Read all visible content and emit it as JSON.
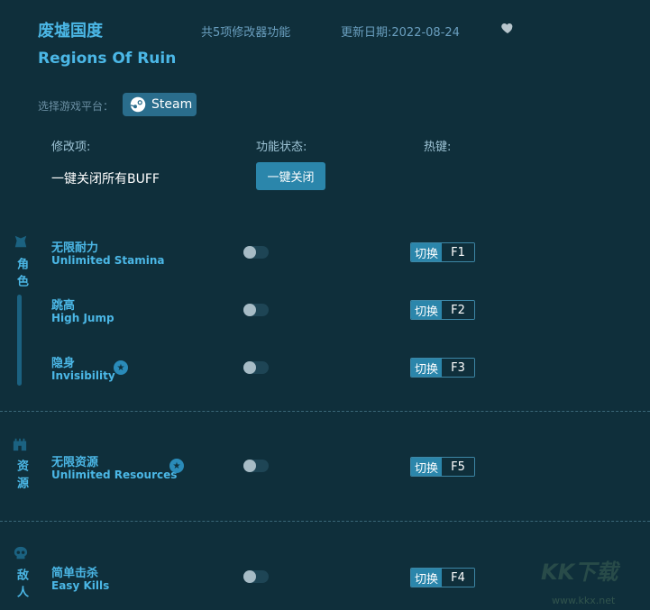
{
  "header": {
    "title_cn": "废墟国度",
    "title_en": "Regions Of Ruin",
    "feature_count": "共5项修改器功能",
    "update_date": "更新日期:2022-08-24",
    "favorite_icon": "heart-icon"
  },
  "platform": {
    "label": "选择游戏平台：",
    "steam_label": "Steam"
  },
  "columns": {
    "mod": "修改项:",
    "status": "功能状态:",
    "hotkey": "热键:"
  },
  "global": {
    "all_buff_label": "一键关闭所有BUFF",
    "close_all_button": "一键关闭"
  },
  "categories": [
    {
      "name": "角色",
      "icon": "character-icon",
      "items": [
        {
          "cn": "无限耐力",
          "en": "Unlimited Stamina",
          "star": false,
          "enabled": false,
          "switch": "切换",
          "key": "F1"
        },
        {
          "cn": "跳高",
          "en": "High Jump",
          "star": false,
          "enabled": false,
          "switch": "切换",
          "key": "F2"
        },
        {
          "cn": "隐身",
          "en": "Invisibility",
          "star": true,
          "enabled": false,
          "switch": "切换",
          "key": "F3"
        }
      ]
    },
    {
      "name": "资源",
      "icon": "castle-icon",
      "items": [
        {
          "cn": "无限资源",
          "en": "Unlimited Resources",
          "star": true,
          "enabled": false,
          "switch": "切换",
          "key": "F5"
        }
      ]
    },
    {
      "name": "敌人",
      "icon": "skull-icon",
      "items": [
        {
          "cn": "简单击杀",
          "en": "Easy Kills",
          "star": false,
          "enabled": false,
          "switch": "切换",
          "key": "F4"
        }
      ]
    }
  ],
  "watermark": {
    "text": "KK下载",
    "url": "www.kkx.net"
  },
  "colors": {
    "background": "#0f2f3b",
    "accent": "#4bb7e6",
    "button": "#2b86ab"
  }
}
